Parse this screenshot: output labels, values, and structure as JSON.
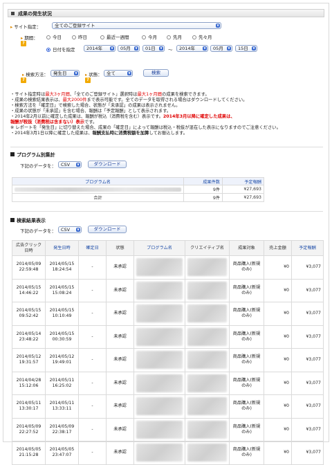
{
  "section_title": "成果の発生状況",
  "filters": {
    "site_label": "サイト指定：",
    "site_value": "全てのご登録サイト",
    "period_label": "期間：",
    "period_options": [
      "今日",
      "昨日",
      "最近一週間",
      "今月",
      "先月",
      "先々月"
    ],
    "date_spec_label": "日付を指定",
    "from_year": "2014年",
    "from_month": "05月",
    "from_day": "01日",
    "tilde": "〜",
    "to_year": "2014年",
    "to_month": "05月",
    "to_day": "15日",
    "search_method_label": "検索方法：",
    "search_method_value": "発生日",
    "status_label": "状態：",
    "status_value": "全て",
    "search_button": "検索"
  },
  "notes": {
    "l1a": "・サイト指定時は",
    "l1b": "最大3ヶ月間",
    "l1c": "、「全てのご登録サイト」選択時は",
    "l1d": "最大1ヶ月間",
    "l1e": "の成果を検索できます。",
    "l2a": "・成果の検索結果表示は、",
    "l2b": "最大2000件",
    "l2c": "まで表示可能です。全てのデータを取得される場合はダウンロードしてください。",
    "l3": "・検索方法を「確定日」で検索した場合、状態が「未承認」の成果は表示されません。",
    "l4": "・成果の状態が「未承認」を含む場合、報酬は「予定報酬」として表示されます。",
    "l5a": "・2014年2月以前に確定した成果は、報酬が税込（消費税を含む）表示です。",
    "l5b": "2014年3月以降に確定した成果は、",
    "l6": "報酬が税抜（消費税は含まない）表示",
    "l6b": "です。",
    "l7": "※ レポートを「発生日」に切り替えた場合、成果の「確定日」によって報酬は税込・税抜が混在した表示になりますのでご注意ください。",
    "l8a": "・2014年3月1日以降に確定した成果は、",
    "l8b": "報酬支払時に消費税額を加算",
    "l8c": "してお振込します。"
  },
  "program_section": {
    "title": "プログラム別集計",
    "download_label": "下記のデータを：",
    "format": "CSV",
    "download_button": "ダウンロード",
    "headers": [
      "プログラム名",
      "成果件数",
      "予定報酬"
    ],
    "rows": [
      {
        "count": "9件",
        "amount": "¥27,693"
      }
    ],
    "total_label": "合計",
    "total_count": "9件",
    "total_amount": "¥27,693"
  },
  "results_section": {
    "title": "検索結果表示",
    "download_label": "下記のデータを：",
    "format": "CSV",
    "download_button": "ダウンロード",
    "headers": [
      "広告クリック日時",
      "発生日時",
      "確定日",
      "状態",
      "プログラム名",
      "クリエイティブ名",
      "成果対象",
      "売上金額",
      "予定報酬"
    ],
    "rows": [
      {
        "click": [
          "2014/05/09",
          "22:59:48"
        ],
        "occur": [
          "2014/05/15",
          "18:24:54"
        ],
        "confirm": "-",
        "status": "未承認",
        "target": [
          "商品購入(新規",
          "のみ)"
        ],
        "sales": "¥0",
        "reward": "¥3,077"
      },
      {
        "click": [
          "2014/05/15",
          "14:46:22"
        ],
        "occur": [
          "2014/05/15",
          "15:08:24"
        ],
        "confirm": "-",
        "status": "未承認",
        "target": [
          "商品購入(新規",
          "のみ)"
        ],
        "sales": "¥0",
        "reward": "¥3,077"
      },
      {
        "click": [
          "2014/05/15",
          "09:52:42"
        ],
        "occur": [
          "2014/05/15",
          "10:10:49"
        ],
        "confirm": "-",
        "status": "未承認",
        "target": [
          "商品購入(新規",
          "のみ)"
        ],
        "sales": "¥0",
        "reward": "¥3,077"
      },
      {
        "click": [
          "2014/05/14",
          "23:48:22"
        ],
        "occur": [
          "2014/05/15",
          "00:30:59"
        ],
        "confirm": "-",
        "status": "未承認",
        "target": [
          "商品購入(新規",
          "のみ)"
        ],
        "sales": "¥0",
        "reward": "¥3,077"
      },
      {
        "click": [
          "2014/05/12",
          "19:31:57"
        ],
        "occur": [
          "2014/05/12",
          "19:49:01"
        ],
        "confirm": "-",
        "status": "未承認",
        "target": [
          "商品購入(新規",
          "のみ)"
        ],
        "sales": "¥0",
        "reward": "¥3,077"
      },
      {
        "click": [
          "2014/04/28",
          "15:12:06"
        ],
        "occur": [
          "2014/05/11",
          "16:25:02"
        ],
        "confirm": "-",
        "status": "未承認",
        "target": [
          "商品購入(新規",
          "のみ)"
        ],
        "sales": "¥0",
        "reward": "¥3,077"
      },
      {
        "click": [
          "2014/05/11",
          "13:30:17"
        ],
        "occur": [
          "2014/05/11",
          "13:33:11"
        ],
        "confirm": "-",
        "status": "未承認",
        "target": [
          "商品購入(新規",
          "のみ)"
        ],
        "sales": "¥0",
        "reward": "¥3,077"
      },
      {
        "click": [
          "2014/05/09",
          "22:27:52"
        ],
        "occur": [
          "2014/05/09",
          "22:38:17"
        ],
        "confirm": "-",
        "status": "未承認",
        "target": [
          "商品購入(新規",
          "のみ)"
        ],
        "sales": "¥0",
        "reward": "¥3,077"
      },
      {
        "click": [
          "2014/05/05",
          "21:15:28"
        ],
        "occur": [
          "2014/05/05",
          "23:47:07"
        ],
        "confirm": "-",
        "status": "未承認",
        "target": [
          "商品購入(新規",
          "のみ)"
        ],
        "sales": "¥0",
        "reward": "¥3,077"
      }
    ]
  },
  "colors": {
    "accent_red": "#e00000",
    "link_blue": "#1f4ea8",
    "help_orange": "#f2a900"
  }
}
